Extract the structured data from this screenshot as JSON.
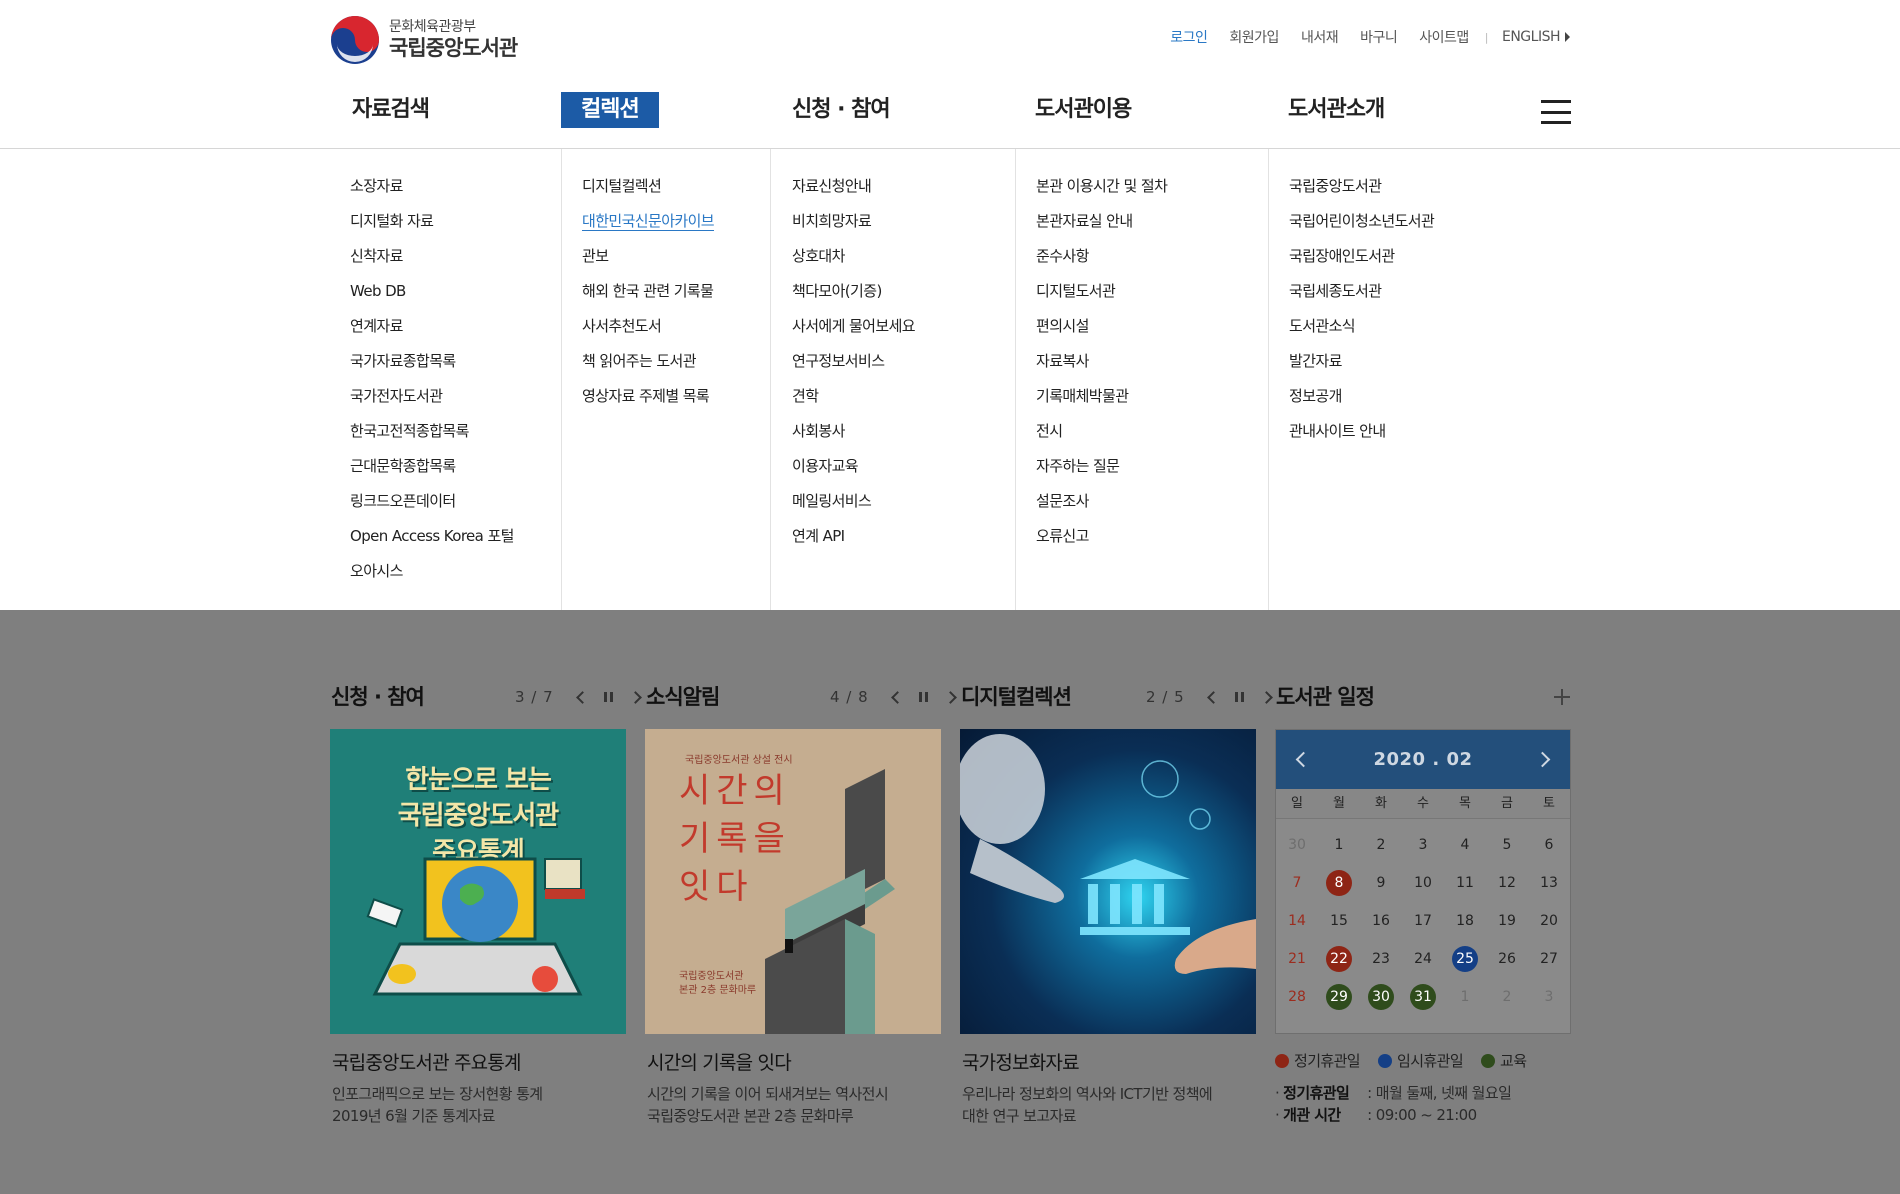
{
  "header": {
    "ministry": "문화체육관광부",
    "library_name": "국립중앙도서관",
    "util_links": [
      "로그인",
      "회원가입",
      "내서재",
      "바구니",
      "사이트맵"
    ],
    "english": "ENGLISH",
    "accent_color": "#2a78c5"
  },
  "gnb": [
    "자료검색",
    "컬렉션",
    "신청 · 참여",
    "도서관이용",
    "도서관소개"
  ],
  "mega_menu": {
    "col1": [
      "소장자료",
      "디지털화 자료",
      "신착자료",
      "Web DB",
      "연계자료",
      "국가자료종합목록",
      "국가전자도서관",
      "한국고전적종합목록",
      "근대문학종합목록",
      "링크드오픈데이터",
      "Open Access Korea 포털",
      "오아시스"
    ],
    "col2": [
      "디지털컬렉션",
      "대한민국신문아카이브",
      "관보",
      "해외 한국 관련 기록물",
      "사서추천도서",
      "책 읽어주는 도서관",
      "영상자료 주제별 목록"
    ],
    "col3": [
      "자료신청안내",
      "비치희망자료",
      "상호대차",
      "책다모아(기증)",
      "사서에게 물어보세요",
      "연구정보서비스",
      "견학",
      "사회봉사",
      "이용자교육",
      "메일링서비스",
      "연계 API"
    ],
    "col4": [
      "본관 이용시간 및 절차",
      "본관자료실 안내",
      "준수사항",
      "디지털도서관",
      "편의시설",
      "자료복사",
      "기록매체박물관",
      "전시",
      "자주하는 질문",
      "설문조사",
      "오류신고"
    ],
    "col5": [
      "국립중앙도서관",
      "국립어린이청소년도서관",
      "국립장애인도서관",
      "국립세종도서관",
      "도서관소식",
      "발간자료",
      "정보공개",
      "관내사이트 안내"
    ]
  },
  "sections": {
    "s1": {
      "title": "신청 · 참여",
      "counter": "3 / 7",
      "image_text": [
        "한눈으로 보는",
        "국립중앙도서관",
        "주요통계"
      ],
      "card_title": "국립중앙도서관 주요통계",
      "card_desc": [
        "인포그래픽으로 보는 장서현황 통계",
        "2019년 6월 기준 통계자료"
      ]
    },
    "s2": {
      "title": "소식알림",
      "counter": "4 / 8",
      "image_small": "국립중앙도서관 상설 전시",
      "image_text": [
        "시간의",
        "기록을",
        "잇다"
      ],
      "image_sub": [
        "국립중앙도서관",
        "본관 2층 문화마루"
      ],
      "card_title": "시간의 기록을 잇다",
      "card_desc": [
        "시간의 기록을 이어 되새겨보는 역사전시",
        "국립중앙도서관 본관 2층 문화마루"
      ]
    },
    "s3": {
      "title": "디지털컬렉션",
      "counter": "2 / 5",
      "card_title": "국가정보화자료",
      "card_desc": [
        "우리나라 정보화의 역사와 ICT기반 정책에",
        "대한 연구 보고자료"
      ]
    },
    "s4": {
      "title": "도서관 일정",
      "month": "2020 . 02",
      "dow": [
        "일",
        "월",
        "화",
        "수",
        "목",
        "금",
        "토"
      ],
      "days": [
        {
          "d": "30",
          "t": "muted"
        },
        {
          "d": "1",
          "t": ""
        },
        {
          "d": "2",
          "t": ""
        },
        {
          "d": "3",
          "t": ""
        },
        {
          "d": "4",
          "t": ""
        },
        {
          "d": "5",
          "t": ""
        },
        {
          "d": "6",
          "t": ""
        },
        {
          "d": "7",
          "t": "sun"
        },
        {
          "d": "8",
          "t": "reg"
        },
        {
          "d": "9",
          "t": ""
        },
        {
          "d": "10",
          "t": ""
        },
        {
          "d": "11",
          "t": ""
        },
        {
          "d": "12",
          "t": ""
        },
        {
          "d": "13",
          "t": ""
        },
        {
          "d": "14",
          "t": "sun"
        },
        {
          "d": "15",
          "t": ""
        },
        {
          "d": "16",
          "t": ""
        },
        {
          "d": "17",
          "t": ""
        },
        {
          "d": "18",
          "t": ""
        },
        {
          "d": "19",
          "t": ""
        },
        {
          "d": "20",
          "t": ""
        },
        {
          "d": "21",
          "t": "sun"
        },
        {
          "d": "22",
          "t": "reg"
        },
        {
          "d": "23",
          "t": ""
        },
        {
          "d": "24",
          "t": ""
        },
        {
          "d": "25",
          "t": "tmp"
        },
        {
          "d": "26",
          "t": ""
        },
        {
          "d": "27",
          "t": ""
        },
        {
          "d": "28",
          "t": "sun"
        },
        {
          "d": "29",
          "t": "edu"
        },
        {
          "d": "30",
          "t": "edu"
        },
        {
          "d": "31",
          "t": "edu"
        },
        {
          "d": "1",
          "t": "muted"
        },
        {
          "d": "2",
          "t": "muted"
        },
        {
          "d": "3",
          "t": "muted"
        }
      ],
      "legend": [
        {
          "label": "정기휴관일",
          "color": "#8e2515"
        },
        {
          "label": "임시휴관일",
          "color": "#143f86"
        },
        {
          "label": "교육",
          "color": "#2f4c1c"
        }
      ],
      "closed_label": "정기휴관일",
      "closed_value": ": 매월 둘째, 넷째 월요일",
      "hours_label": "개관 시간",
      "hours_value": ": 09:00 ~ 21:00"
    }
  }
}
